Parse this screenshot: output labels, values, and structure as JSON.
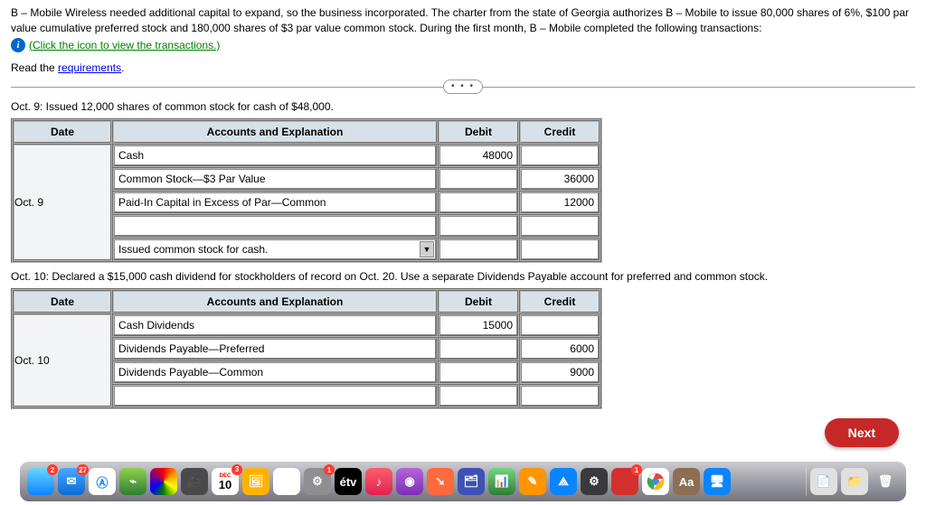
{
  "intro": {
    "paragraph": "B – Mobile Wireless needed additional capital to expand, so the business incorporated. The charter from the state of Georgia authorizes B – Mobile to issue 80,000 shares of 6%, $100 par value cumulative preferred stock and 180,000 shares of $3 par value common stock. During the first month, B – Mobile completed the following transactions:",
    "click_link": "(Click the icon to view the transactions.)",
    "read_prefix": "Read the ",
    "requirements_link": "requirements",
    "period": "."
  },
  "separator": {
    "ellipsis": "• • •"
  },
  "entry1": {
    "label": "Oct. 9: Issued 12,000 shares of common stock for cash of $48,000.",
    "headers": {
      "date": "Date",
      "acct": "Accounts and Explanation",
      "debit": "Debit",
      "credit": "Credit"
    },
    "date": "Oct. 9",
    "rows": [
      {
        "acct": "Cash",
        "debit": "48000",
        "credit": ""
      },
      {
        "acct": "Common Stock—$3 Par Value",
        "debit": "",
        "credit": "36000"
      },
      {
        "acct": "Paid-In Capital in Excess of Par—Common",
        "debit": "",
        "credit": "12000"
      },
      {
        "acct": "",
        "debit": "",
        "credit": ""
      }
    ],
    "explanation": "Issued common stock for cash."
  },
  "entry2": {
    "label": "Oct. 10: Declared a $15,000 cash dividend for stockholders of record on Oct. 20. Use a separate Dividends Payable account for preferred and common stock.",
    "headers": {
      "date": "Date",
      "acct": "Accounts and Explanation",
      "debit": "Debit",
      "credit": "Credit"
    },
    "date": "Oct. 10",
    "rows": [
      {
        "acct": "Cash Dividends",
        "debit": "15000",
        "credit": ""
      },
      {
        "acct": "Dividends Payable—Preferred",
        "debit": "",
        "credit": "6000"
      },
      {
        "acct": "Dividends Payable—Common",
        "debit": "",
        "credit": "9000"
      },
      {
        "acct": "",
        "debit": "",
        "credit": ""
      }
    ]
  },
  "next_label": "Next",
  "dock": {
    "badge_finder": "2",
    "badge_mail": "27",
    "badge_cal": "3",
    "cal_month": "DEC",
    "cal_day": "10",
    "badge_sys": "1",
    "badge_adobe": "1",
    "tv": "étv",
    "aa": "Aa"
  }
}
